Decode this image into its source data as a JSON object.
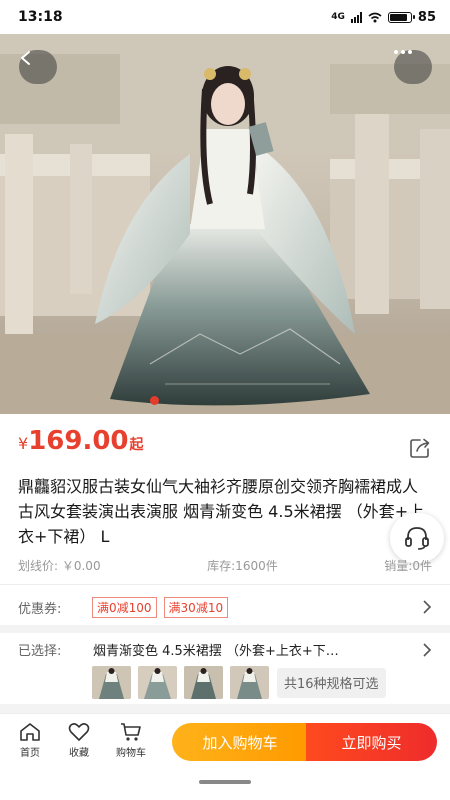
{
  "status_bar": {
    "time": "13:18",
    "battery": "85",
    "network": "4G",
    "battery_fraction": 0.85
  },
  "product": {
    "price_currency": "¥",
    "price": "169.00",
    "price_suffix": "起",
    "title": "鼎龘貂汉服古装女仙气大袖衫齐腰原创交领齐胸襦裙成人古风女套装演出表演服 烟青渐变色 4.5米裙摆 （外套+上衣+下裙） L",
    "list_price": "划线价: ￥0.00",
    "stock": "库存:1600件",
    "sales": "销量:0件"
  },
  "promotions": {
    "label": "优惠券:",
    "coupons": [
      "满0减100",
      "满30减10"
    ]
  },
  "selection": {
    "label": "已选择:",
    "value": "烟青渐变色 4.5米裙摆 （外套+上衣+下…",
    "spec_count": "共16种规格可选"
  },
  "bottom_bar": {
    "home": "首页",
    "favorite": "收藏",
    "cart": "购物车",
    "add_to_cart": "加入购物车",
    "buy_now": "立即购买"
  },
  "icons": {
    "back": "chevron-left-icon",
    "more": "more-dots-icon",
    "share": "share-icon",
    "customer_service": "headset-icon",
    "chevron": "chevron-right-icon",
    "home": "home-icon",
    "favorite": "heart-icon",
    "cart": "cart-icon"
  },
  "colors": {
    "price": "#e8402e",
    "add_to_cart": "#ff9a00",
    "buy_now": "#ee2c2c"
  }
}
